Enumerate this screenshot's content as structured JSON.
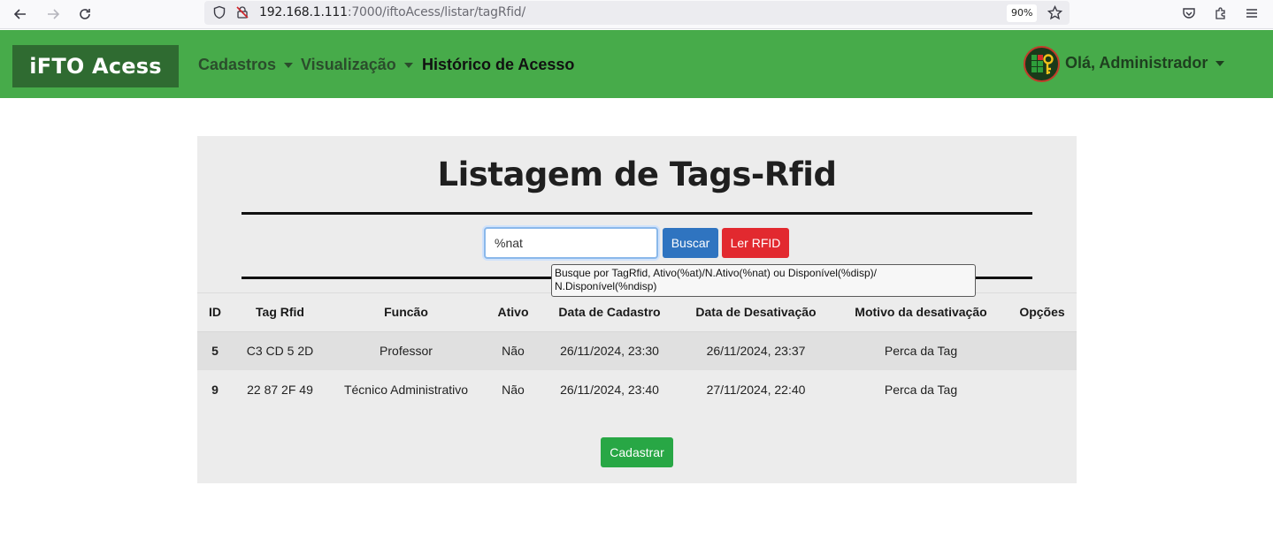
{
  "browser": {
    "url_host": "192.168.1.111",
    "url_rest": ":7000/iftoAcess/listar/tagRfid/",
    "zoom": "90%",
    "icons": [
      "back-arrow-icon",
      "forward-arrow-icon",
      "reload-icon",
      "shield-icon",
      "insecure-lock-icon",
      "bookmark-star-icon",
      "pocket-icon",
      "extensions-icon",
      "menu-icon"
    ]
  },
  "navbar": {
    "brand": "iFTO Acess",
    "items": [
      {
        "label": "Cadastros",
        "dropdown": true
      },
      {
        "label": "Visualização",
        "dropdown": true
      },
      {
        "label": "Histórico de Acesso",
        "dropdown": false
      }
    ],
    "user_greeting": "Olá, Administrador",
    "colors": {
      "navbar": "#47ab4a",
      "brand_bg": "#2f6b31"
    }
  },
  "main": {
    "title": "Listagem de Tags-Rfid",
    "search": {
      "value": "%nat",
      "placeholder": ""
    },
    "buscar_label": "Buscar",
    "ler_rfid_label": "Ler RFID",
    "tooltip": "Busque por TagRfid, Ativo(%at)/N.Ativo(%nat) ou Disponível(%disp)/ N.Disponível(%ndisp)",
    "table": {
      "headers": [
        "ID",
        "Tag Rfid",
        "Funcão",
        "Ativo",
        "Data de Cadastro",
        "Data de Desativação",
        "Motivo da desativação",
        "Opções"
      ],
      "rows": [
        [
          "5",
          "C3 CD 5 2D",
          "Professor",
          "Não",
          "26/11/2024, 23:30",
          "26/11/2024, 23:37",
          "Perca da Tag",
          ""
        ],
        [
          "9",
          "22 87 2F 49",
          "Técnico Administrativo",
          "Não",
          "26/11/2024, 23:40",
          "27/11/2024, 22:40",
          "Perca da Tag",
          ""
        ]
      ]
    },
    "cadastrar_label": "Cadastrar",
    "colors": {
      "buscar": "#2f74c0",
      "ler_rfid": "#e2292f",
      "cadastrar": "#28a745"
    }
  }
}
